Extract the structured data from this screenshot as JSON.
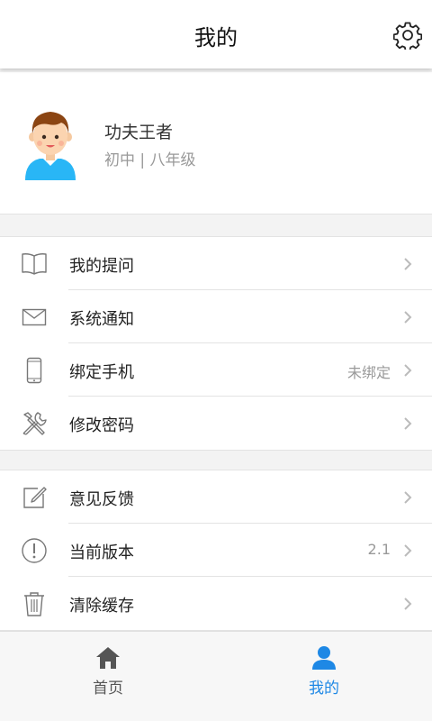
{
  "header": {
    "title": "我的",
    "settings_icon": "gear-icon"
  },
  "profile": {
    "name": "功夫王者",
    "grade": "初中 | 八年级",
    "avatar_icon": "boy-avatar"
  },
  "menu_groups": [
    {
      "items": [
        {
          "label": "我的提问",
          "value": "",
          "icon": "book-icon"
        },
        {
          "label": "系统通知",
          "value": "",
          "icon": "envelope-icon"
        },
        {
          "label": "绑定手机",
          "value": "未绑定",
          "icon": "phone-icon"
        },
        {
          "label": "修改密码",
          "value": "",
          "icon": "tools-icon"
        }
      ]
    },
    {
      "items": [
        {
          "label": "意见反馈",
          "value": "",
          "icon": "edit-icon"
        },
        {
          "label": "当前版本",
          "value": "2.1",
          "icon": "info-icon"
        },
        {
          "label": "清除缓存",
          "value": "",
          "icon": "trash-icon"
        }
      ]
    }
  ],
  "tabbar": {
    "tabs": [
      {
        "label": "首页",
        "icon": "home-icon",
        "active": false
      },
      {
        "label": "我的",
        "icon": "user-icon",
        "active": true
      }
    ],
    "active_color": "#1e88e5",
    "inactive_color": "#555555"
  }
}
